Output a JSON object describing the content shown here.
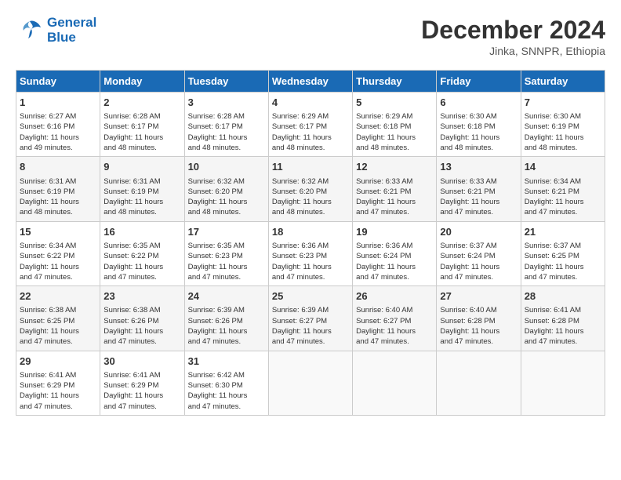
{
  "header": {
    "logo_line1": "General",
    "logo_line2": "Blue",
    "month": "December 2024",
    "location": "Jinka, SNNPR, Ethiopia"
  },
  "weekdays": [
    "Sunday",
    "Monday",
    "Tuesday",
    "Wednesday",
    "Thursday",
    "Friday",
    "Saturday"
  ],
  "weeks": [
    [
      {
        "day": "1",
        "info": "Sunrise: 6:27 AM\nSunset: 6:16 PM\nDaylight: 11 hours\nand 49 minutes."
      },
      {
        "day": "2",
        "info": "Sunrise: 6:28 AM\nSunset: 6:17 PM\nDaylight: 11 hours\nand 48 minutes."
      },
      {
        "day": "3",
        "info": "Sunrise: 6:28 AM\nSunset: 6:17 PM\nDaylight: 11 hours\nand 48 minutes."
      },
      {
        "day": "4",
        "info": "Sunrise: 6:29 AM\nSunset: 6:17 PM\nDaylight: 11 hours\nand 48 minutes."
      },
      {
        "day": "5",
        "info": "Sunrise: 6:29 AM\nSunset: 6:18 PM\nDaylight: 11 hours\nand 48 minutes."
      },
      {
        "day": "6",
        "info": "Sunrise: 6:30 AM\nSunset: 6:18 PM\nDaylight: 11 hours\nand 48 minutes."
      },
      {
        "day": "7",
        "info": "Sunrise: 6:30 AM\nSunset: 6:19 PM\nDaylight: 11 hours\nand 48 minutes."
      }
    ],
    [
      {
        "day": "8",
        "info": "Sunrise: 6:31 AM\nSunset: 6:19 PM\nDaylight: 11 hours\nand 48 minutes."
      },
      {
        "day": "9",
        "info": "Sunrise: 6:31 AM\nSunset: 6:19 PM\nDaylight: 11 hours\nand 48 minutes."
      },
      {
        "day": "10",
        "info": "Sunrise: 6:32 AM\nSunset: 6:20 PM\nDaylight: 11 hours\nand 48 minutes."
      },
      {
        "day": "11",
        "info": "Sunrise: 6:32 AM\nSunset: 6:20 PM\nDaylight: 11 hours\nand 48 minutes."
      },
      {
        "day": "12",
        "info": "Sunrise: 6:33 AM\nSunset: 6:21 PM\nDaylight: 11 hours\nand 47 minutes."
      },
      {
        "day": "13",
        "info": "Sunrise: 6:33 AM\nSunset: 6:21 PM\nDaylight: 11 hours\nand 47 minutes."
      },
      {
        "day": "14",
        "info": "Sunrise: 6:34 AM\nSunset: 6:21 PM\nDaylight: 11 hours\nand 47 minutes."
      }
    ],
    [
      {
        "day": "15",
        "info": "Sunrise: 6:34 AM\nSunset: 6:22 PM\nDaylight: 11 hours\nand 47 minutes."
      },
      {
        "day": "16",
        "info": "Sunrise: 6:35 AM\nSunset: 6:22 PM\nDaylight: 11 hours\nand 47 minutes."
      },
      {
        "day": "17",
        "info": "Sunrise: 6:35 AM\nSunset: 6:23 PM\nDaylight: 11 hours\nand 47 minutes."
      },
      {
        "day": "18",
        "info": "Sunrise: 6:36 AM\nSunset: 6:23 PM\nDaylight: 11 hours\nand 47 minutes."
      },
      {
        "day": "19",
        "info": "Sunrise: 6:36 AM\nSunset: 6:24 PM\nDaylight: 11 hours\nand 47 minutes."
      },
      {
        "day": "20",
        "info": "Sunrise: 6:37 AM\nSunset: 6:24 PM\nDaylight: 11 hours\nand 47 minutes."
      },
      {
        "day": "21",
        "info": "Sunrise: 6:37 AM\nSunset: 6:25 PM\nDaylight: 11 hours\nand 47 minutes."
      }
    ],
    [
      {
        "day": "22",
        "info": "Sunrise: 6:38 AM\nSunset: 6:25 PM\nDaylight: 11 hours\nand 47 minutes."
      },
      {
        "day": "23",
        "info": "Sunrise: 6:38 AM\nSunset: 6:26 PM\nDaylight: 11 hours\nand 47 minutes."
      },
      {
        "day": "24",
        "info": "Sunrise: 6:39 AM\nSunset: 6:26 PM\nDaylight: 11 hours\nand 47 minutes."
      },
      {
        "day": "25",
        "info": "Sunrise: 6:39 AM\nSunset: 6:27 PM\nDaylight: 11 hours\nand 47 minutes."
      },
      {
        "day": "26",
        "info": "Sunrise: 6:40 AM\nSunset: 6:27 PM\nDaylight: 11 hours\nand 47 minutes."
      },
      {
        "day": "27",
        "info": "Sunrise: 6:40 AM\nSunset: 6:28 PM\nDaylight: 11 hours\nand 47 minutes."
      },
      {
        "day": "28",
        "info": "Sunrise: 6:41 AM\nSunset: 6:28 PM\nDaylight: 11 hours\nand 47 minutes."
      }
    ],
    [
      {
        "day": "29",
        "info": "Sunrise: 6:41 AM\nSunset: 6:29 PM\nDaylight: 11 hours\nand 47 minutes."
      },
      {
        "day": "30",
        "info": "Sunrise: 6:41 AM\nSunset: 6:29 PM\nDaylight: 11 hours\nand 47 minutes."
      },
      {
        "day": "31",
        "info": "Sunrise: 6:42 AM\nSunset: 6:30 PM\nDaylight: 11 hours\nand 47 minutes."
      },
      {
        "day": "",
        "info": ""
      },
      {
        "day": "",
        "info": ""
      },
      {
        "day": "",
        "info": ""
      },
      {
        "day": "",
        "info": ""
      }
    ]
  ]
}
